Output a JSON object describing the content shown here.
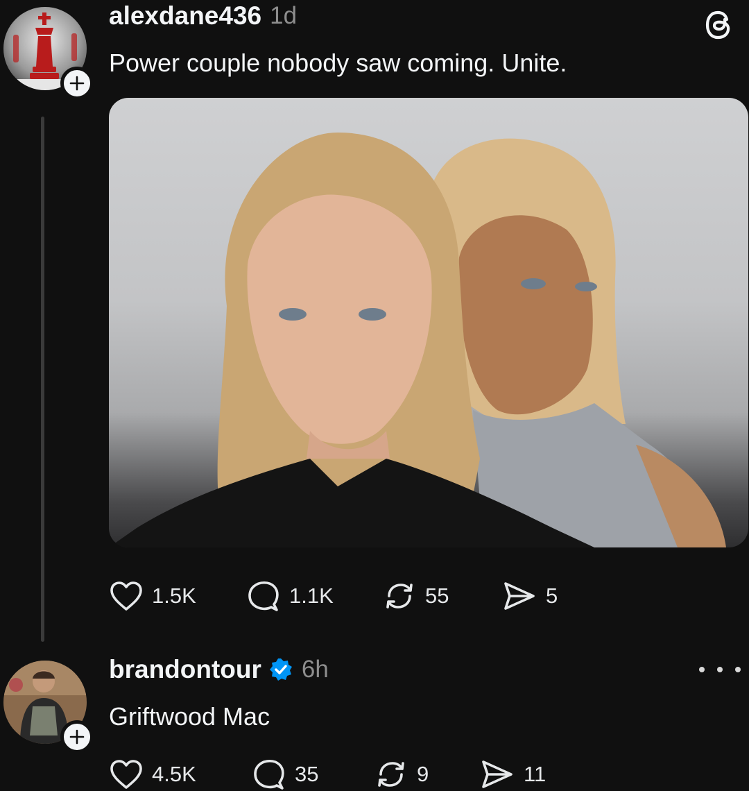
{
  "post1": {
    "username": "alexdane436",
    "time": "1d",
    "text": "Power couple nobody saw coming. Unite.",
    "avatar_icon": "chess-king-icon",
    "stats": {
      "likes": "1.5K",
      "replies": "1.1K",
      "reposts": "55",
      "shares": "5"
    }
  },
  "post2": {
    "username": "brandontour",
    "time": "6h",
    "text": "Griftwood Mac",
    "verified": true,
    "stats": {
      "likes": "4.5K",
      "replies": "35",
      "reposts": "9",
      "shares": "11"
    }
  },
  "colors": {
    "background": "#101010",
    "text": "#f3f5f7",
    "muted": "#8e8e8e",
    "verified": "#0095f6"
  }
}
